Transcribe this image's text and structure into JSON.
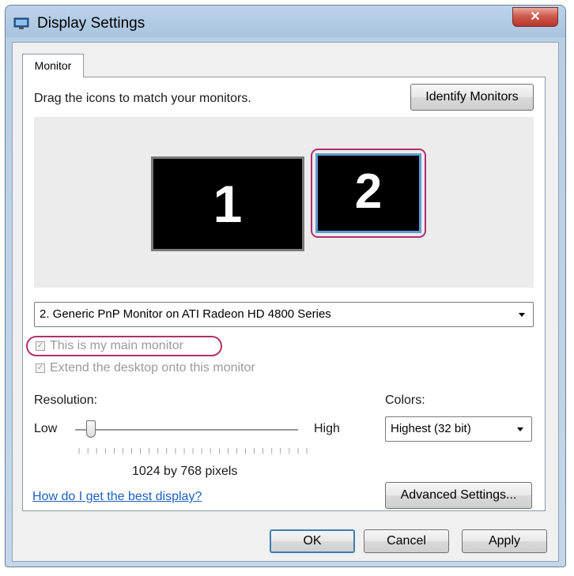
{
  "window": {
    "title": "Display Settings",
    "close_glyph": "✕"
  },
  "tabs": [
    {
      "label": "Monitor",
      "active": true
    }
  ],
  "monitor_tab": {
    "instructions": "Drag the icons to match your monitors.",
    "identify_button": "Identify Monitors",
    "monitors": [
      {
        "number": "1",
        "selected": false
      },
      {
        "number": "2",
        "selected": true
      }
    ],
    "monitor_select": "2. Generic PnP Monitor on ATI Radeon HD 4800 Series",
    "checkbox_main": {
      "label": "This is my main monitor",
      "checked": true,
      "enabled": false
    },
    "checkbox_extend": {
      "label": "Extend the desktop onto this monitor",
      "checked": true,
      "enabled": false
    },
    "resolution": {
      "label": "Resolution:",
      "low": "Low",
      "high": "High",
      "value_text": "1024 by 768 pixels",
      "slider_position": 0.08
    },
    "colors": {
      "label": "Colors:",
      "selected": "Highest (32 bit)"
    },
    "help_link": "How do I get the best display?",
    "advanced_button": "Advanced Settings..."
  },
  "footer": {
    "ok": "OK",
    "cancel": "Cancel",
    "apply": "Apply"
  },
  "colors_theme": {
    "highlight_ring": "#b0306b",
    "selected_monitor_border": "#5f9bd3",
    "link": "#1e5fbf"
  }
}
